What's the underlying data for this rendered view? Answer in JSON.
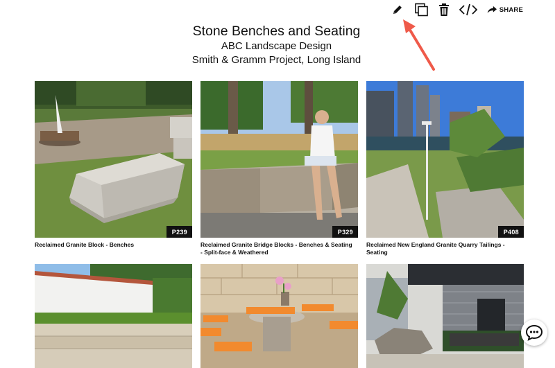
{
  "toolbar": {
    "share_label": "SHARE",
    "icons": [
      "pencil-icon",
      "duplicate-icon",
      "trash-icon",
      "code-icon",
      "share-icon"
    ]
  },
  "header": {
    "title": "Stone Benches and Seating",
    "company": "ABC Landscape Design",
    "project": "Smith & Gramm Project, Long Island"
  },
  "cards": [
    {
      "code": "P239",
      "caption": "Reclaimed Granite Block - Benches"
    },
    {
      "code": "P329",
      "caption": "Reclaimed Granite Bridge Blocks - Benches & Seating - Split-face & Weathered"
    },
    {
      "code": "P408",
      "caption": "Reclaimed New England Granite Quarry Tailings - Seating"
    }
  ],
  "colors": {
    "annotation_arrow": "#ef5a4a",
    "tag_bg": "#111111"
  }
}
